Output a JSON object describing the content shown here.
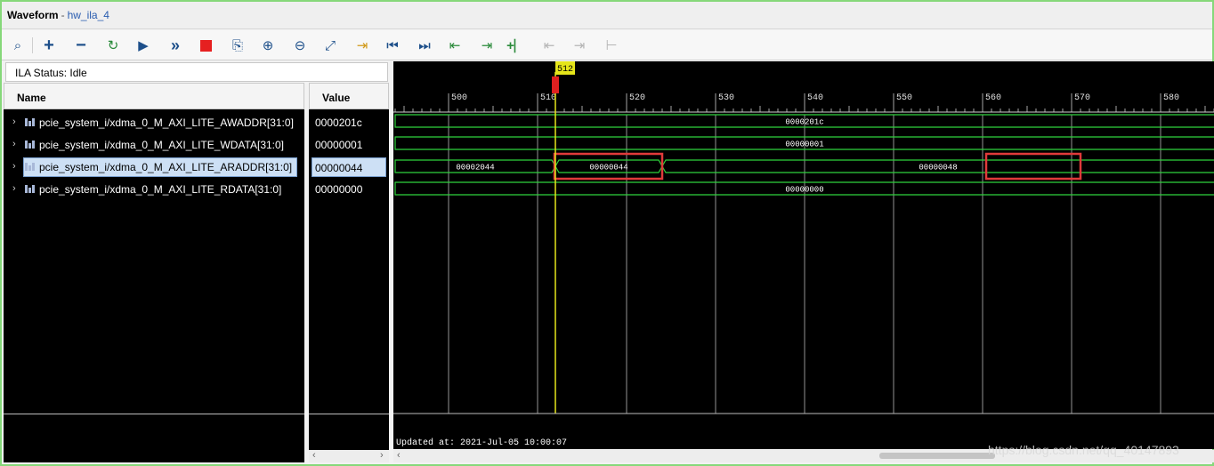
{
  "window": {
    "title": "Waveform",
    "separator": "-",
    "subtitle": "hw_ila_4"
  },
  "toolbar": {
    "items": [
      {
        "icon": "search-icon",
        "glyph": "🔍"
      },
      {
        "icon": "add-icon",
        "glyph": "+"
      },
      {
        "icon": "remove-icon",
        "glyph": "−"
      },
      {
        "icon": "refresh-run-icon",
        "glyph": "↻"
      },
      {
        "icon": "run-trigger-icon",
        "glyph": "▶"
      },
      {
        "icon": "run-immediate-icon",
        "glyph": "»"
      },
      {
        "icon": "stop-icon",
        "glyph": ""
      },
      {
        "icon": "export-icon",
        "glyph": "⇱"
      },
      {
        "icon": "zoom-in-icon",
        "glyph": "⊕"
      },
      {
        "icon": "zoom-out-icon",
        "glyph": "⊖"
      },
      {
        "icon": "zoom-fit-icon",
        "glyph": "⤢"
      },
      {
        "icon": "goto-cursor-icon",
        "glyph": "⇥"
      },
      {
        "icon": "goto-start-icon",
        "glyph": "⏮"
      },
      {
        "icon": "goto-end-icon",
        "glyph": "⏭"
      },
      {
        "icon": "prev-transition-icon",
        "glyph": "⇤"
      },
      {
        "icon": "next-transition-icon",
        "glyph": "⇥"
      },
      {
        "icon": "add-marker-icon",
        "glyph": "+"
      },
      {
        "icon": "prev-marker-icon",
        "glyph": "⇤"
      },
      {
        "icon": "next-marker-icon",
        "glyph": "⇥"
      },
      {
        "icon": "swap-cursors-icon",
        "glyph": "⊢"
      }
    ]
  },
  "ila_status": "ILA Status:  Idle",
  "columns": {
    "name": "Name",
    "value": "Value"
  },
  "signals": [
    {
      "name": "pcie_system_i/xdma_0_M_AXI_LITE_AWADDR[31:0]",
      "value": "0000201c",
      "selected": false
    },
    {
      "name": "pcie_system_i/xdma_0_M_AXI_LITE_WDATA[31:0]",
      "value": "00000001",
      "selected": false
    },
    {
      "name": "pcie_system_i/xdma_0_M_AXI_LITE_ARADDR[31:0]",
      "value": "00000044",
      "selected": true
    },
    {
      "name": "pcie_system_i/xdma_0_M_AXI_LITE_RDATA[31:0]",
      "value": "00000000",
      "selected": false
    }
  ],
  "waveform": {
    "cursor_label": "512",
    "cursor_sample": 512,
    "tick_labels": [
      "500",
      "510",
      "520",
      "530",
      "540",
      "550",
      "560",
      "570",
      "580"
    ],
    "tick_start": 500,
    "tick_step": 10,
    "traces": [
      {
        "segments": [
          {
            "value": "0000201c",
            "from": 494,
            "to": 592
          }
        ]
      },
      {
        "segments": [
          {
            "value": "00000001",
            "from": 494,
            "to": 592
          }
        ]
      },
      {
        "segments": [
          {
            "value": "00002044",
            "from": 494,
            "to": 512
          },
          {
            "value": "00000044",
            "from": 512,
            "to": 524
          },
          {
            "value": "00000048",
            "from": 524,
            "to": 592
          }
        ]
      },
      {
        "segments": [
          {
            "value": "00000000",
            "from": 494,
            "to": 592
          }
        ]
      }
    ],
    "updated_at": "Updated at: 2021-Jul-05 10:00:07",
    "highlight_boxes": [
      {
        "label": "00000044",
        "from": 512,
        "to": 524,
        "trace": 2
      },
      {
        "label": "00000048",
        "from": 560.5,
        "to": 571,
        "trace": 2
      }
    ],
    "colors": {
      "trace": "#2fd23c",
      "cursor": "#e5e51a",
      "marker": "#e02020",
      "grid": "#b8b8b8",
      "highlight": "#e03a3a"
    }
  },
  "watermark": "https://blog.csdn.net/qq_40147893"
}
